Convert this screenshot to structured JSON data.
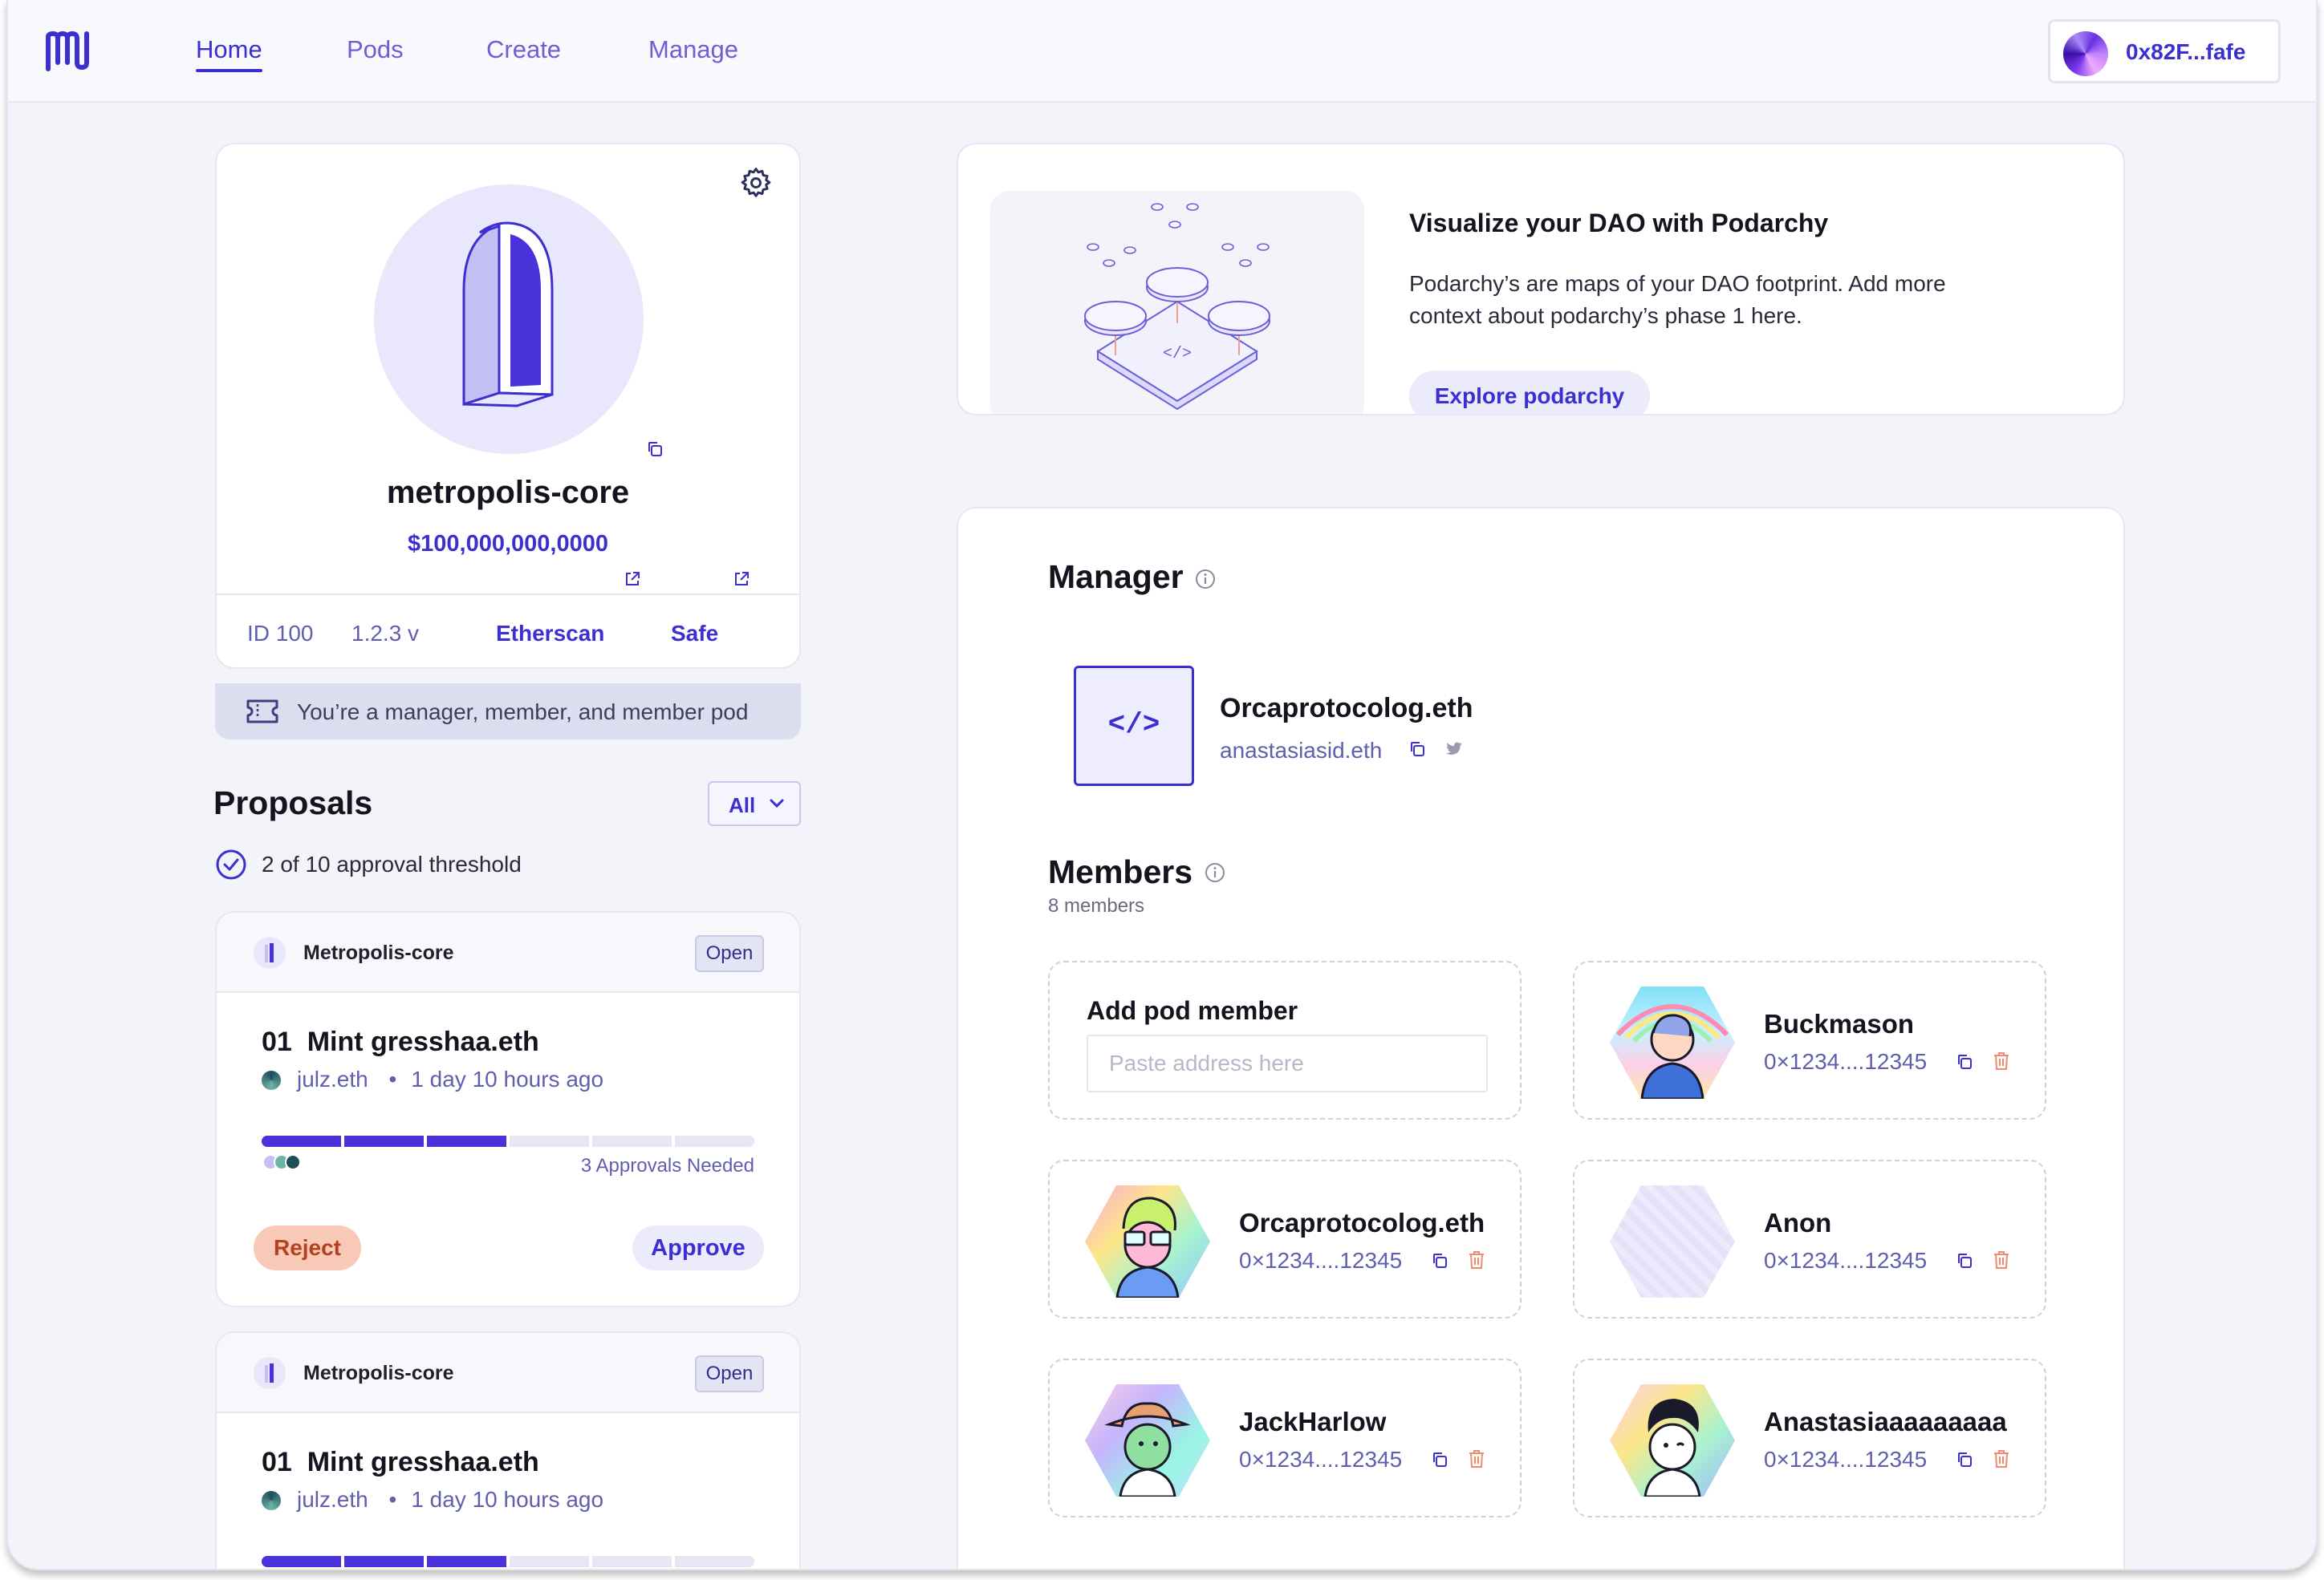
{
  "header": {
    "nav": [
      "Home",
      "Pods",
      "Create",
      "Manage"
    ],
    "active_nav": "Home",
    "wallet_address": "0x82F...fafe"
  },
  "pod": {
    "name": "metropolis-core",
    "value": "$100,000,000,0000",
    "id": "ID 100",
    "version": "1.2.3 v",
    "etherscan_label": "Etherscan",
    "safe_label": "Safe",
    "role_text": "You’re a manager, member, and member pod"
  },
  "proposals": {
    "title": "Proposals",
    "filter_value": "All",
    "threshold_text": "2 of 10 approval threshold",
    "items": [
      {
        "pod_label": "Metropolis-core",
        "status": "Open",
        "number": "01",
        "title": "Mint gresshaa.eth",
        "author": "julz.eth",
        "separator": "•",
        "time": "1 day 10 hours ago",
        "approvals_needed": "3 Approvals Needed",
        "approved_segments": 3,
        "total_segments": 6,
        "reject_label": "Reject",
        "approve_label": "Approve"
      },
      {
        "pod_label": "Metropolis-core",
        "status": "Open",
        "number": "01",
        "title": "Mint gresshaa.eth",
        "author": "julz.eth",
        "separator": "•",
        "time": "1 day 10 hours ago",
        "approved_segments": 3,
        "total_segments": 6
      }
    ]
  },
  "podarchy": {
    "title": "Visualize your DAO with Podarchy",
    "description": "Podarchy’s are maps of your DAO footprint. Add more context about podarchy’s phase 1 here.",
    "button": "Explore podarchy",
    "code_glyph": "</>"
  },
  "manager": {
    "title": "Manager",
    "name": "Orcaprotocolog.eth",
    "ens": "anastasiasid.eth",
    "code_glyph": "</>"
  },
  "members": {
    "title": "Members",
    "count_text": "8 members",
    "add_title": "Add pod member",
    "add_placeholder": "Paste address here",
    "list": [
      {
        "name": "Buckmason",
        "address": "0×1234....12345"
      },
      {
        "name": "Orcaprotocolog.eth",
        "address": "0×1234....12345"
      },
      {
        "name": "Anon",
        "address": "0×1234....12345"
      },
      {
        "name": "JackHarlow",
        "address": "0×1234....12345"
      },
      {
        "name": "Anastasiaaaaaaaaa",
        "address": "0×1234....12345"
      }
    ]
  },
  "colors": {
    "accent": "#3b2fd2",
    "reject_bg": "#f9c9b8",
    "progress_fill": "#4a32db",
    "progress_empty": "#e6e7f3"
  }
}
